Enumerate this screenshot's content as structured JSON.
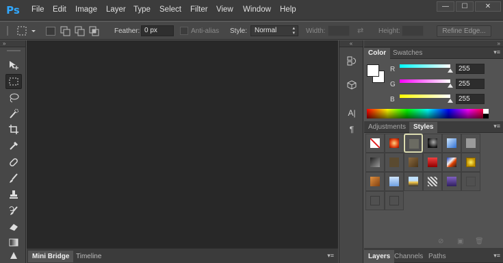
{
  "app": {
    "logo": "Ps"
  },
  "menu": [
    "File",
    "Edit",
    "Image",
    "Layer",
    "Type",
    "Select",
    "Filter",
    "View",
    "Window",
    "Help"
  ],
  "window_controls": {
    "minimize": "—",
    "maximize": "☐",
    "close": "✕"
  },
  "options_bar": {
    "feather_label": "Feather:",
    "feather_value": "0 px",
    "antialias_label": "Anti-alias",
    "style_label": "Style:",
    "style_value": "Normal",
    "width_label": "Width:",
    "height_label": "Height:",
    "refine_edge": "Refine Edge..."
  },
  "toolbar_head": "»",
  "tools": [
    "move-tool",
    "rectangular-marquee-tool",
    "lasso-tool",
    "quick-selection-tool",
    "crop-tool",
    "eyedropper-tool",
    "spot-healing-brush-tool",
    "brush-tool",
    "clone-stamp-tool",
    "history-brush-tool",
    "eraser-tool",
    "gradient-tool",
    "blur-tool"
  ],
  "bottom_tabs": [
    "Mini Bridge",
    "Timeline"
  ],
  "dock_icons": [
    "history-icon",
    "3d-icon",
    "character-icon",
    "paragraph-icon"
  ],
  "color_panel": {
    "tabs": [
      "Color",
      "Swatches"
    ],
    "channels": [
      {
        "label": "R",
        "value": "255",
        "color": "#00ffff"
      },
      {
        "label": "G",
        "value": "255",
        "color": "#ff00ff"
      },
      {
        "label": "B",
        "value": "255",
        "color": "#ffff00"
      }
    ]
  },
  "styles_panel": {
    "tabs": [
      "Adjustments",
      "Styles"
    ]
  },
  "layers_panel": {
    "tabs": [
      "Layers",
      "Channels",
      "Paths"
    ]
  },
  "colors": {
    "canvas_bg": "#282828",
    "panel_bg": "#535353",
    "accent_logo": "#31a8ff"
  }
}
